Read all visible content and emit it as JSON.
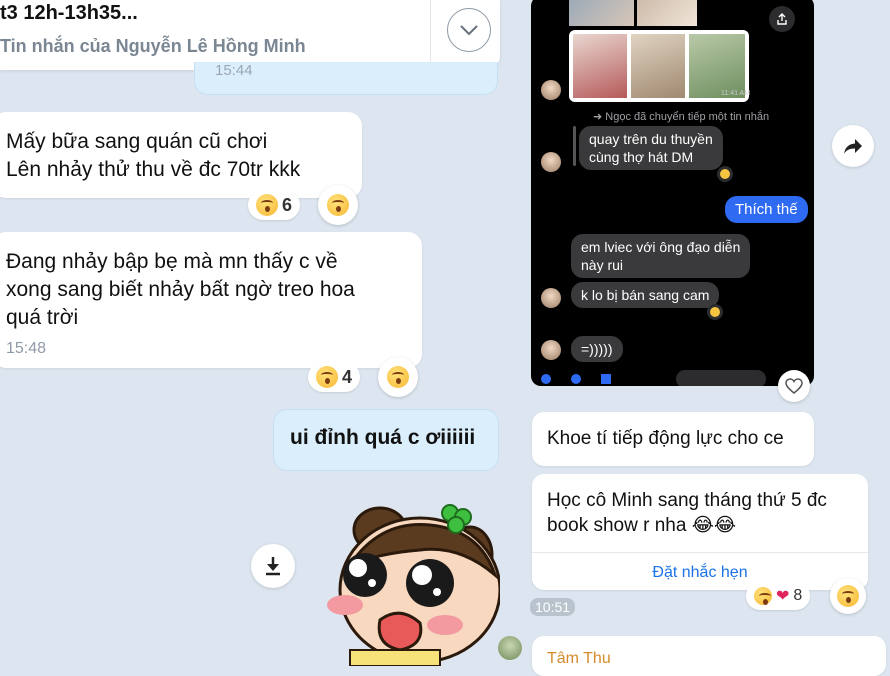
{
  "pinned": {
    "title": "t3 12h-13h35...",
    "subtitle": "Tin nhắn của Nguyễn Lê Hồng Minh",
    "partial_time": "15:44"
  },
  "messages": [
    {
      "line1": "Mấy bữa sang quán cũ chơi",
      "line2": "Lên nhảy thử thu về đc 70tr kkk",
      "reaction_count": "6"
    },
    {
      "line1": "Đang nhảy bập bẹ mà  mn thấy c về",
      "line2": "xong sang biết nhảy bất ngờ treo hoa",
      "line3": "quá trời",
      "time": "15:48",
      "reaction_count": "4"
    },
    {
      "text": "ui đỉnh quá c ơiiiiii"
    }
  ],
  "phone": {
    "forward_note": "➜ Ngọc đã chuyển tiếp một tin nhắn",
    "photo_time": "11:41 AM",
    "bubbles": [
      {
        "line1": "quay trên du thuyền",
        "line2": "cùng thợ hát DM"
      },
      {
        "mine": "Thích thế"
      },
      {
        "line1": "em lviec với ông đạo diễn",
        "line2": "này rui"
      },
      {
        "line1": "k lo bị bán sang cam"
      },
      {
        "line1": "=)))))"
      }
    ]
  },
  "right": {
    "msg1": "Khoe tí tiếp động lực cho ce",
    "msg2_line1": "Học cô Minh sang tháng thứ 5 đc",
    "msg2_line2": "book show r nha 😂😂",
    "reminder_label": "Đặt nhắc hẹn",
    "time": "10:51",
    "reaction_count": "8",
    "sender": "Tâm Thu"
  },
  "icons": {
    "chevron": "chevron-down-icon",
    "download": "download-icon",
    "share": "share-forward-icon",
    "heart": "heart-icon"
  }
}
